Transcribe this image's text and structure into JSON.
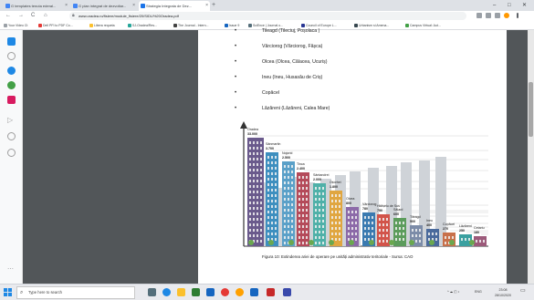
{
  "browser": {
    "tabs": [
      {
        "label": "G templates tenuta ederal..."
      },
      {
        "label": "G plan integrat de dezvoltar..."
      },
      {
        "label": "Strategia Integrata de Dez..."
      }
    ],
    "new_tab": "+",
    "window_controls": {
      "minimize": "–",
      "maximize": "□",
      "close": "✕"
    },
    "nav": {
      "back": "←",
      "forward": "→",
      "reload": "C",
      "home": "⌂"
    },
    "url": "www.oradea.ro/fisiere/module_fisiere/20/SIDU%20Oradea.pdf",
    "bookmarks": [
      "Your Video Ct",
      "Dell PFI to PDF Co...",
      "Libera requeta",
      "SJ-Oradea/Res...",
      "The Journal - Intern...",
      "Issue 9",
      "SciEnce | Journal o...",
      "Council of Europe L...",
      "Urbanism si Amena...",
      "Campus Virtual: Aut..."
    ]
  },
  "document": {
    "bullets": [
      "Tileagd (Tileciuj, Poșolaca )",
      "Vârciorog (Vârciorog, Fâșca)",
      "Olcea (Olcea, Călacea, Ucuriș)",
      "Ineu (Ineu, Husasău de Criș)",
      "Copăcel",
      "Lăzăreni (Lăzăreni, Calea Mare)"
    ],
    "bullet_symbol": "•",
    "chart_labels": [
      {
        "name": "Oradea",
        "value": "33.000"
      },
      {
        "name": "Sânmartin",
        "value": "3.700"
      },
      {
        "name": "Nojorid",
        "value": "2.500"
      },
      {
        "name": "Tinca",
        "value": "2.400"
      },
      {
        "name": "Sântandrei",
        "value": "2.000"
      },
      {
        "name": "Oșorhei",
        "value": "1.800"
      },
      {
        "name": "Olcea",
        "value": "800"
      },
      {
        "name": "Vârciorog",
        "value": "780"
      },
      {
        "name": "Hidișelu de Sus",
        "value": "750"
      },
      {
        "name": "Sălard",
        "value": "600"
      },
      {
        "name": "Tileagd",
        "value": "500"
      },
      {
        "name": "Ineu",
        "value": "400"
      },
      {
        "name": "Copăcel",
        "value": "270"
      },
      {
        "name": "Lăzăreni",
        "value": "250"
      },
      {
        "name": "Cetariu",
        "value": "180"
      }
    ],
    "caption": "Figura 10: Extinderea ariei de operare pe unități administrativ teritoriale - Sursa: CAO"
  },
  "taskbar": {
    "search_placeholder": "Type here to search",
    "search_icon": "magnifier-icon",
    "time": "23:08",
    "date": "28/10/2020",
    "lang": "ENG"
  }
}
